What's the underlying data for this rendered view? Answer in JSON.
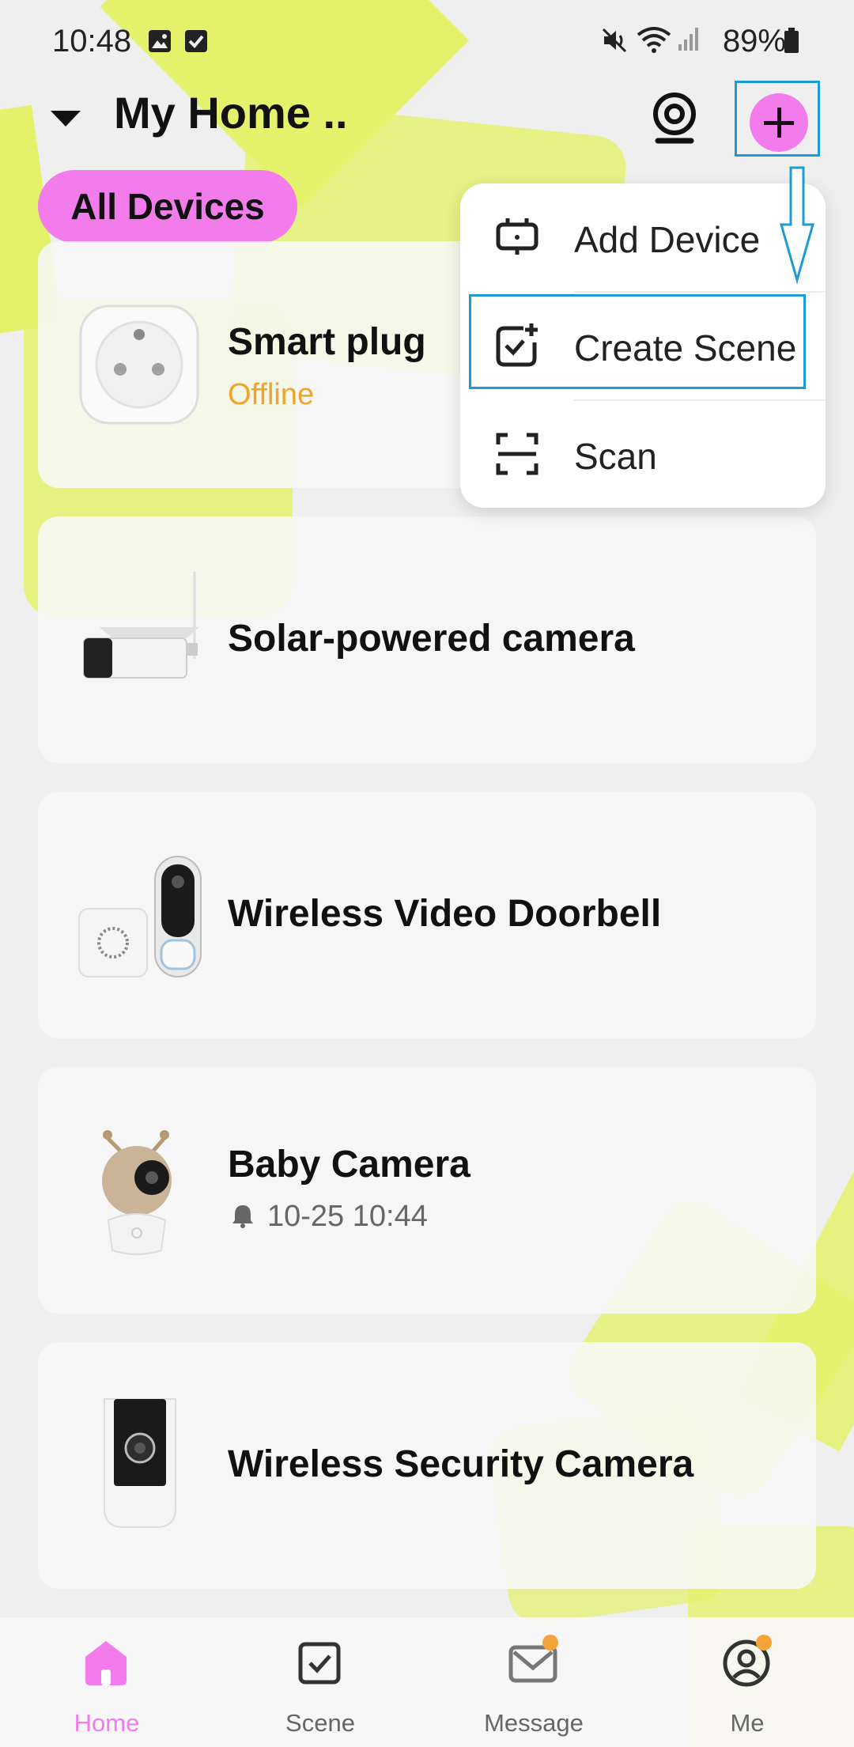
{
  "status_bar": {
    "time": "10:48",
    "battery": "89%"
  },
  "header": {
    "home_name": "My Home .."
  },
  "filter": {
    "active_chip": "All Devices"
  },
  "devices": [
    {
      "name": "Smart plug",
      "status": "Offline"
    },
    {
      "name": "Solar-powered camera"
    },
    {
      "name": "Wireless Video Doorbell"
    },
    {
      "name": "Baby Camera",
      "event_time": "10-25 10:44"
    },
    {
      "name": "Wireless Security Camera"
    }
  ],
  "add_menu": {
    "items": [
      {
        "label": "Add Device",
        "icon": "add-device-icon"
      },
      {
        "label": "Create Scene",
        "icon": "create-scene-icon"
      },
      {
        "label": "Scan",
        "icon": "scan-icon"
      }
    ]
  },
  "tabs": [
    {
      "label": "Home",
      "icon": "home-icon",
      "active": true
    },
    {
      "label": "Scene",
      "icon": "scene-icon"
    },
    {
      "label": "Message",
      "icon": "message-icon",
      "badge": true
    },
    {
      "label": "Me",
      "icon": "profile-icon",
      "badge": true
    }
  ],
  "colors": {
    "accent": "#f37cec",
    "highlight": "#1d9bd6",
    "offline": "#f0a42a",
    "badge": "#f5a23b",
    "decor": "#e4f26b"
  }
}
